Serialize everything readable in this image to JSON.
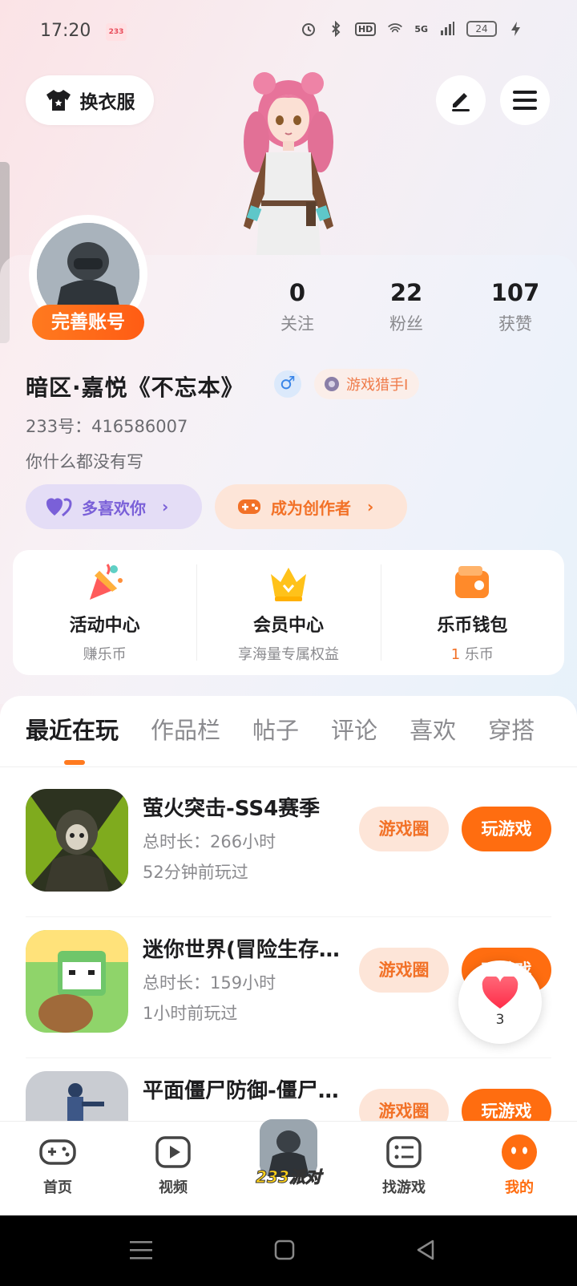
{
  "status_bar": {
    "time": "17:20",
    "app_icon_text": "233",
    "battery": "24",
    "network": "5G",
    "hd": "HD"
  },
  "header": {
    "dress_up_label": "换衣服"
  },
  "profile": {
    "complete_account_label": "完善账号",
    "stats": [
      {
        "value": "0",
        "label": "关注"
      },
      {
        "value": "22",
        "label": "粉丝"
      },
      {
        "value": "107",
        "label": "获赞"
      }
    ],
    "username": "暗区·嘉悦《不忘本》",
    "gender_symbol": "♂",
    "badge_label": "游戏猎手I",
    "uid": "233号：416586007",
    "bio": "你什么都没有写",
    "like_you_label": "多喜欢你",
    "creator_label": "成为创作者"
  },
  "services": [
    {
      "title": "活动中心",
      "subtitle": "赚乐币",
      "icon": "party-popper-icon"
    },
    {
      "title": "会员中心",
      "subtitle": "享海量专属权益",
      "icon": "crown-icon"
    },
    {
      "title": "乐币钱包",
      "subtitle_value": "1",
      "subtitle_unit": "乐币",
      "icon": "wallet-icon"
    }
  ],
  "tabs": [
    {
      "label": "最近在玩",
      "active": true
    },
    {
      "label": "作品栏",
      "active": false
    },
    {
      "label": "帖子",
      "active": false
    },
    {
      "label": "评论",
      "active": false
    },
    {
      "label": "喜欢",
      "active": false
    },
    {
      "label": "穿搭",
      "active": false
    }
  ],
  "games": [
    {
      "title": "萤火突击-SS4赛季",
      "duration": "总时长：266小时",
      "last_played": "52分钟前玩过",
      "circle_label": "游戏圈",
      "play_label": "玩游戏"
    },
    {
      "title": "迷你世界(冒险生存…",
      "duration": "总时长：159小时",
      "last_played": "1小时前玩过",
      "circle_label": "游戏圈",
      "play_label": "玩游戏"
    },
    {
      "title": "平面僵尸防御-僵尸…",
      "duration": "",
      "last_played": "",
      "circle_label": "游戏圈",
      "play_label": "玩游戏"
    }
  ],
  "floating": {
    "heart_count": "3"
  },
  "bottom_nav": {
    "home": "首页",
    "video": "视频",
    "center": "233派对",
    "find_game": "找游戏",
    "mine": "我的"
  },
  "colors": {
    "accent": "#ff6d10",
    "accent_light": "#fde5d8",
    "purple": "#7a60d8",
    "purple_light": "#e4ddf6"
  }
}
